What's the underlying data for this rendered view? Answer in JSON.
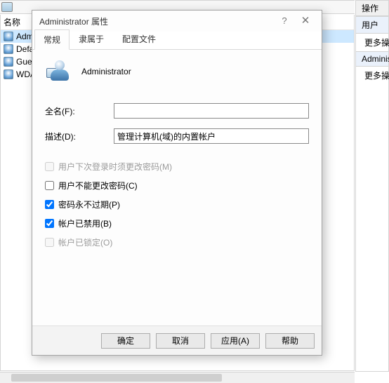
{
  "bg": {
    "name_col": "名称",
    "users": [
      {
        "label": "Administrator",
        "selected": true
      },
      {
        "label": "DefaultAccount",
        "selected": false
      },
      {
        "label": "Guest",
        "selected": false
      },
      {
        "label": "WDAGUtilityAccount",
        "selected": false
      }
    ],
    "ops_header": "操作",
    "ops_group1": "用户",
    "ops_more1": "更多操作",
    "ops_group2": "Administrator",
    "ops_more2": "更多操作"
  },
  "dialog": {
    "title": "Administrator 属性",
    "tabs": {
      "general": "常规",
      "memberof": "隶属于",
      "profile": "配置文件"
    },
    "username": "Administrator",
    "labels": {
      "fullname": "全名(F):",
      "description": "描述(D):"
    },
    "fields": {
      "fullname": "",
      "description": "管理计算机(域)的内置帐户"
    },
    "checkboxes": {
      "must_change": {
        "label": "用户下次登录时须更改密码(M)",
        "checked": false,
        "disabled": true
      },
      "cannot_change": {
        "label": "用户不能更改密码(C)",
        "checked": false,
        "disabled": false
      },
      "never_expires": {
        "label": "密码永不过期(P)",
        "checked": true,
        "disabled": false
      },
      "is_disabled": {
        "label": "帐户已禁用(B)",
        "checked": true,
        "disabled": false
      },
      "is_locked": {
        "label": "帐户已锁定(O)",
        "checked": false,
        "disabled": true
      }
    },
    "buttons": {
      "ok": "确定",
      "cancel": "取消",
      "apply": "应用(A)",
      "help": "帮助"
    }
  }
}
